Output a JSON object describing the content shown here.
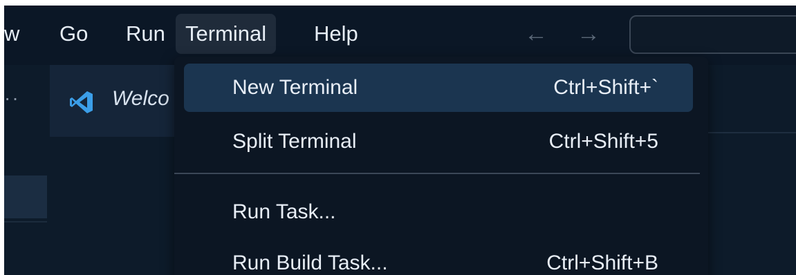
{
  "menubar": {
    "items": [
      {
        "label": "w"
      },
      {
        "label": "Go"
      },
      {
        "label": "Run"
      },
      {
        "label": "Terminal",
        "active": true
      },
      {
        "label": "Help"
      }
    ],
    "nav": {
      "back_icon": "arrow-left-icon",
      "back_glyph": "←",
      "forward_icon": "arrow-right-icon",
      "forward_glyph": "→"
    },
    "search": {
      "value": "",
      "placeholder": ""
    }
  },
  "sidebar": {
    "more_glyph": "··"
  },
  "editor": {
    "tab": {
      "label": "Welco",
      "icon": "vscode-logo-icon"
    }
  },
  "terminal_menu": {
    "items": [
      {
        "label": "New Terminal",
        "shortcut": "Ctrl+Shift+`",
        "highlighted": true
      },
      {
        "label": "Split Terminal",
        "shortcut": "Ctrl+Shift+5"
      },
      {
        "label": "Run Task...",
        "shortcut": ""
      },
      {
        "label": "Run Build Task...",
        "shortcut": "Ctrl+Shift+B"
      }
    ]
  },
  "colors": {
    "background": "#0d1b2a",
    "menu_highlight": "#1b3550",
    "vscode_blue": "#3b9ee8"
  }
}
